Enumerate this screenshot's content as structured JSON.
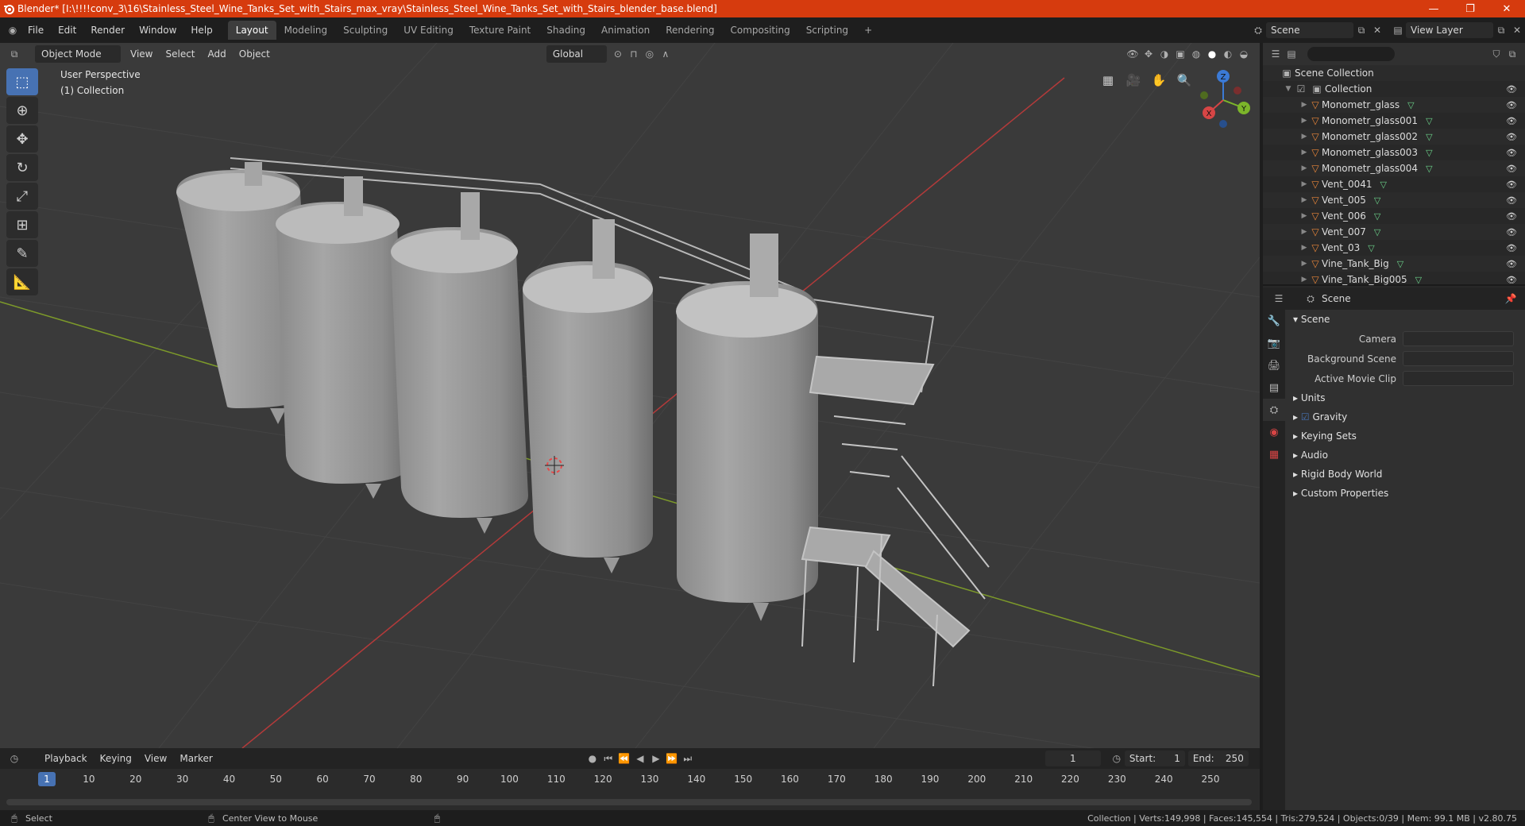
{
  "window": {
    "title": "Blender* [I:\\!!!!conv_3\\16\\Stainless_Steel_Wine_Tanks_Set_with_Stairs_max_vray\\Stainless_Steel_Wine_Tanks_Set_with_Stairs_blender_base.blend]",
    "minimize": "—",
    "maximize": "❐",
    "close": "✕"
  },
  "menu": [
    "File",
    "Edit",
    "Render",
    "Window",
    "Help"
  ],
  "workspaces": [
    "Layout",
    "Modeling",
    "Sculpting",
    "UV Editing",
    "Texture Paint",
    "Shading",
    "Animation",
    "Rendering",
    "Compositing",
    "Scripting"
  ],
  "workspace_add": "+",
  "scene_field": "Scene",
  "viewlayer_field": "View Layer",
  "viewport": {
    "mode": "Object Mode",
    "menus": [
      "View",
      "Select",
      "Add",
      "Object"
    ],
    "transform": "Global",
    "info_line1": "User Perspective",
    "info_line2": "(1) Collection"
  },
  "gizmo": {
    "x": "X",
    "y": "Y",
    "z": "Z"
  },
  "outliner": {
    "search_placeholder": "",
    "scene_collection": "Scene Collection",
    "collection": "Collection",
    "items": [
      "Monometr_glass",
      "Monometr_glass001",
      "Monometr_glass002",
      "Monometr_glass003",
      "Monometr_glass004",
      "Vent_0041",
      "Vent_005",
      "Vent_006",
      "Vent_007",
      "Vent_03",
      "Vine_Tank_Big",
      "Vine_Tank_Big005"
    ]
  },
  "properties": {
    "header": "Scene",
    "section": "Scene",
    "camera_label": "Camera",
    "bg_scene_label": "Background Scene",
    "movie_clip_label": "Active Movie Clip",
    "subsections": [
      "Units",
      "Gravity",
      "Keying Sets",
      "Audio",
      "Rigid Body World",
      "Custom Properties"
    ]
  },
  "timeline": {
    "menus": [
      "Playback",
      "Keying",
      "View",
      "Marker"
    ],
    "current_frame": "1",
    "start_label": "Start:",
    "start": "1",
    "end_label": "End:",
    "end": "250",
    "ruler": [
      "1",
      "10",
      "20",
      "30",
      "40",
      "50",
      "60",
      "70",
      "80",
      "90",
      "100",
      "110",
      "120",
      "130",
      "140",
      "150",
      "160",
      "170",
      "180",
      "190",
      "200",
      "210",
      "220",
      "230",
      "240",
      "250"
    ]
  },
  "status": {
    "left": "Select",
    "middle": "Center View to Mouse",
    "right": "Collection | Verts:149,998 | Faces:145,554 | Tris:279,524 | Objects:0/39 | Mem: 99.1 MB | v2.80.75"
  }
}
